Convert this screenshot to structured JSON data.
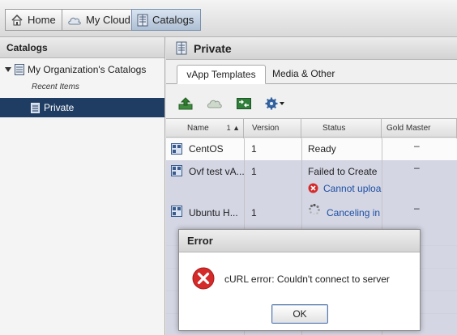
{
  "nav": {
    "tabs": [
      {
        "label": "Home",
        "icon": "home-icon"
      },
      {
        "label": "My Cloud",
        "icon": "cloud-icon"
      },
      {
        "label": "Catalogs",
        "icon": "catalog-icon",
        "active": true
      }
    ]
  },
  "sidebar": {
    "title": "Catalogs",
    "root_label": "My Organization's Catalogs",
    "recent_label": "Recent Items",
    "selected_item": "Private"
  },
  "main": {
    "title": "Private",
    "tabs": [
      {
        "label": "vApp Templates",
        "active": true
      },
      {
        "label": "Media & Other",
        "active": false
      }
    ],
    "toolbar": [
      "upload-icon",
      "cloud-icon",
      "move-icon",
      "gear-dropdown-icon"
    ],
    "table": {
      "columns": [
        "Name",
        "Version",
        "Status",
        "Gold Master"
      ],
      "sort_indicator": "1 ▲",
      "rows": [
        {
          "name": "CentOS",
          "version": "1",
          "status": "Ready",
          "status_detail": "",
          "gold": "–"
        },
        {
          "name": "Ovf test vA...",
          "version": "1",
          "status": "Failed to Create",
          "status_detail": "Cannot uploa",
          "gold": "–"
        },
        {
          "name": "Ubuntu H...",
          "version": "1",
          "status": "Canceling in",
          "status_detail": "",
          "gold": "–"
        }
      ]
    }
  },
  "dialog": {
    "title": "Error",
    "message": "cURL error: Couldn't connect to server",
    "ok_label": "OK"
  },
  "colors": {
    "selection_bg": "#1f3d63",
    "row_highlight": "#d4d6e4",
    "error_red": "#d42a2a",
    "link_blue": "#1d4fa3"
  }
}
